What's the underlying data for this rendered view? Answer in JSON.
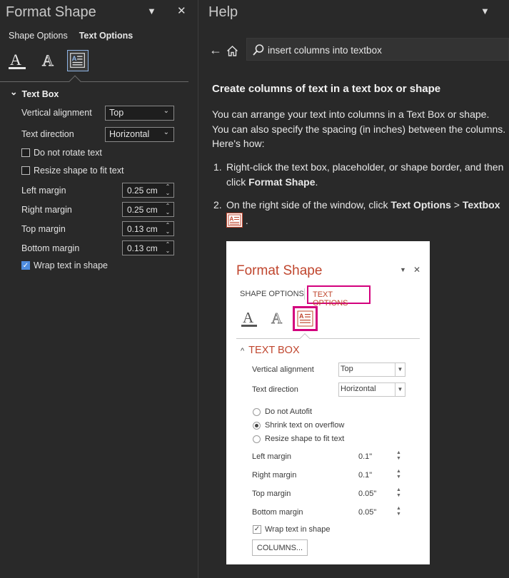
{
  "format_pane": {
    "title": "Format Shape",
    "dropdown_glyph": "▼",
    "close_glyph": "✕",
    "tabs": [
      "Shape Options",
      "Text Options"
    ],
    "active_tab": "Text Options",
    "icons": [
      "text-fill-outline-icon",
      "text-effects-icon",
      "textbox-icon"
    ],
    "section": {
      "chevron": "⌄",
      "label": "Text Box"
    },
    "vertical_alignment": {
      "label": "Vertical alignment",
      "value": "Top"
    },
    "text_direction": {
      "label": "Text direction",
      "value": "Horizontal"
    },
    "do_not_rotate": {
      "label": "Do not rotate text",
      "checked": false
    },
    "resize_shape": {
      "label": "Resize shape to fit text",
      "checked": false
    },
    "margins": [
      {
        "label": "Left margin",
        "value": "0.25 cm"
      },
      {
        "label": "Right margin",
        "value": "0.25 cm"
      },
      {
        "label": "Top margin",
        "value": "0.13 cm"
      },
      {
        "label": "Bottom margin",
        "value": "0.13 cm"
      }
    ],
    "wrap_text": {
      "label": "Wrap text in shape",
      "checked": true,
      "mark": "✓"
    }
  },
  "help_pane": {
    "title": "Help",
    "dropdown_glyph": "▼",
    "back_glyph": "←",
    "search_value": "insert columns into textbox",
    "heading": "Create columns of text in a text box or shape",
    "intro": "You can arrange your text into columns in a Text Box or shape. You can also specify the spacing (in inches) between the columns. Here's how:",
    "step1": {
      "num": "1.",
      "text": "Right-click the text box, placeholder, or shape border, and then click ",
      "bold": "Format Shape",
      "end": "."
    },
    "step2": {
      "num": "2.",
      "text": "On the right side of the window, click ",
      "bold1": "Text Options",
      "sep": " > ",
      "bold2": "Textbox",
      "end": " ."
    }
  },
  "embedded": {
    "title": "Format Shape",
    "dropdown_glyph": "▼",
    "close_glyph": "✕",
    "tab1": "SHAPE OPTIONS",
    "tab2": "TEXT OPTIONS",
    "section": "TEXT BOX",
    "section_glyph": "^",
    "vertical_alignment": {
      "label": "Vertical alignment",
      "value": "Top"
    },
    "text_direction": {
      "label": "Text direction",
      "value": "Horizontal"
    },
    "radios": [
      {
        "label": "Do not Autofit",
        "selected": false
      },
      {
        "label": "Shrink text on overflow",
        "selected": true
      },
      {
        "label": "Resize shape to fit text",
        "selected": false
      }
    ],
    "margins": [
      {
        "label": "Left margin",
        "value": "0.1\""
      },
      {
        "label": "Right margin",
        "value": "0.1\""
      },
      {
        "label": "Top margin",
        "value": "0.05\""
      },
      {
        "label": "Bottom margin",
        "value": "0.05\""
      }
    ],
    "wrap": {
      "label": "Wrap text in shape",
      "checked": true,
      "mark": "✓"
    },
    "columns_button": "COLUMNS..."
  },
  "colors": {
    "accent_red": "#c0462e",
    "highlight_magenta": "#d3007d",
    "checkbox_blue": "#4f8ddf"
  }
}
